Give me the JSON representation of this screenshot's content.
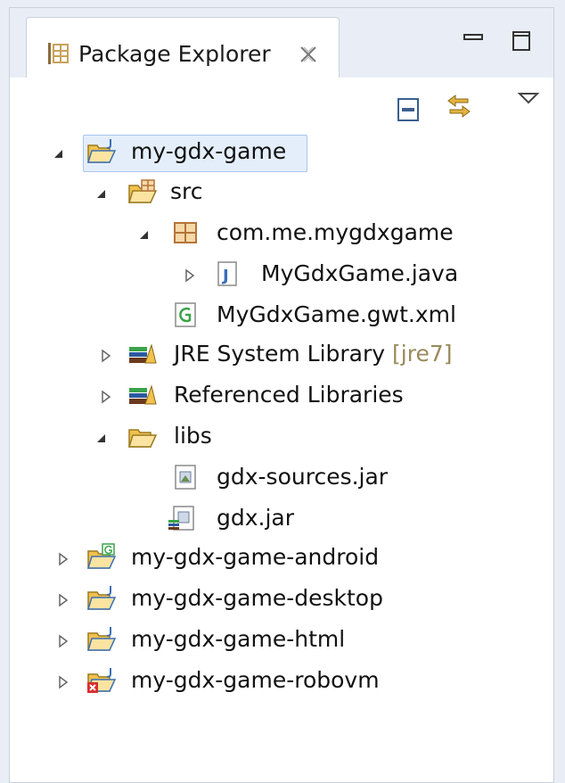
{
  "view": {
    "title": "Package Explorer"
  },
  "tree": [
    {
      "label": "my-gdx-game",
      "expanded": true,
      "selected": true,
      "icon": "java-project-icon"
    },
    {
      "label": "src",
      "expanded": true,
      "icon": "source-folder-icon"
    },
    {
      "label": "com.me.mygdxgame",
      "expanded": true,
      "icon": "package-icon"
    },
    {
      "label": "MyGdxGame.java",
      "expanded": false,
      "icon": "java-file-icon"
    },
    {
      "label": "MyGdxGame.gwt.xml",
      "icon": "gwt-xml-icon"
    },
    {
      "label": "JRE System Library",
      "decoration": "[jre7]",
      "expanded": false,
      "icon": "library-icon"
    },
    {
      "label": "Referenced Libraries",
      "expanded": false,
      "icon": "library-icon"
    },
    {
      "label": "libs",
      "expanded": true,
      "icon": "folder-icon"
    },
    {
      "label": "gdx-sources.jar",
      "icon": "jar-file-icon"
    },
    {
      "label": "gdx.jar",
      "icon": "jar-library-icon"
    },
    {
      "label": "my-gdx-game-android",
      "expanded": false,
      "icon": "android-project-icon"
    },
    {
      "label": "my-gdx-game-desktop",
      "expanded": false,
      "icon": "java-project-icon"
    },
    {
      "label": "my-gdx-game-html",
      "expanded": false,
      "icon": "java-project-icon"
    },
    {
      "label": "my-gdx-game-robovm",
      "expanded": false,
      "icon": "java-project-error-icon"
    }
  ],
  "colors": {
    "selection_fill": "#e4eefb",
    "selection_border": "#a7c7ee",
    "decoration_text": "#9a8a5c",
    "folder_yellow": "#f2c14e",
    "java_blue": "#3b6fb6",
    "error_red": "#d62f2f"
  }
}
